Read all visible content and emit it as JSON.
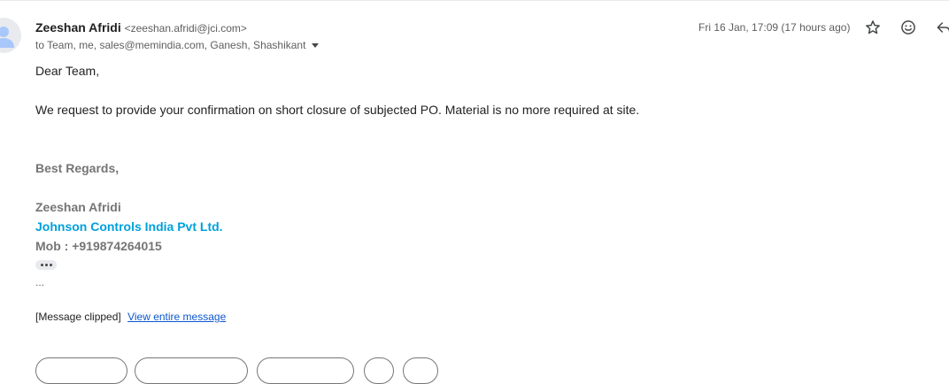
{
  "header": {
    "sender_name": "Zeeshan Afridi",
    "sender_email": "<zeeshan.afridi@jci.com>",
    "recipients": "to Team, me, sales@memindia.com, Ganesh, Shashikant",
    "date": "Fri 16 Jan, 17:09 (17 hours ago)",
    "icons": {
      "avatar": "person-avatar-icon",
      "star": "star-icon",
      "emoji": "emoji-icon",
      "reply": "reply-icon",
      "caret": "chevron-down-icon"
    }
  },
  "body": {
    "greeting": "Dear Team,",
    "message": "We request to provide your confirmation on short closure of subjected PO. Material is no more required at site.",
    "regards": "Best Regards,",
    "signature_name": "Zeeshan Afridi",
    "signature_company": "Johnson Controls India Pvt Ltd.",
    "signature_mobile": "Mob : +919874264015",
    "ellipsis": "...",
    "clipped_text": "[Message clipped]",
    "view_entire_link": "View entire message"
  },
  "colors": {
    "company": "#00a0dc",
    "link": "#0b57d0",
    "signature_gray": "#757575"
  }
}
